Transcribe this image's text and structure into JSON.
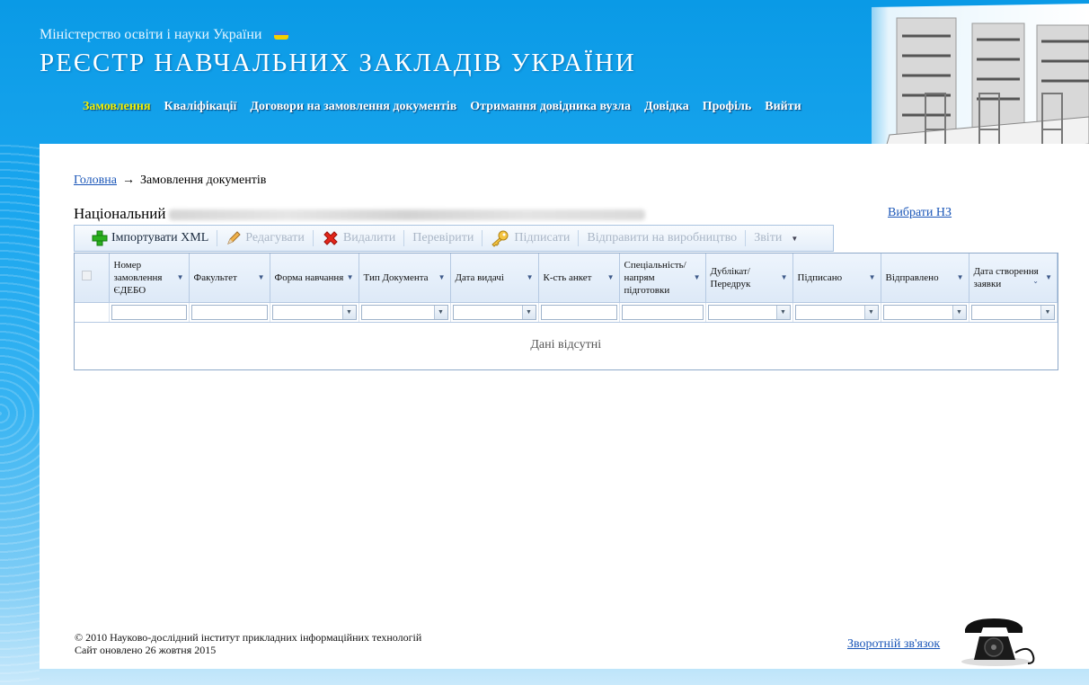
{
  "header": {
    "ministry": "Міністерство освіти і науки України",
    "title": "РЕЄСТР НАВЧАЛЬНИХ ЗАКЛАДІВ УКРАЇНИ",
    "nav": [
      {
        "label": "Замовлення",
        "active": true
      },
      {
        "label": "Кваліфікації"
      },
      {
        "label": "Договори на замовлення документів"
      },
      {
        "label": "Отримання довідника вузла"
      },
      {
        "label": "Довідка"
      },
      {
        "label": "Профіль"
      },
      {
        "label": "Вийти"
      }
    ]
  },
  "breadcrumb": {
    "home": "Головна",
    "arrow": "→",
    "current": "Замовлення документів"
  },
  "institution": {
    "prefix": "Національний",
    "choose_link": "Вибрати НЗ"
  },
  "toolbar": {
    "import": "Імпортувати XML",
    "edit": "Редагувати",
    "delete": "Видалити",
    "check": "Перевірити",
    "sign": "Підписати",
    "send": "Відправити на виробництво",
    "reports": "Звіти"
  },
  "grid": {
    "columns": [
      "Номер замовлення ЄДЕБО",
      "Факультет",
      "Форма навчання",
      "Тип Документа",
      "Дата видачі",
      "К-сть анкет",
      "Спеціальність/ напрям підготовки",
      "Дублікат/ Передрук",
      "Підписано",
      "Відправлено",
      "Дата створення заявки"
    ],
    "empty_text": "Дані відсутні"
  },
  "footer": {
    "copyright": "© 2010 Науково-дослідний інститут прикладних інформаційних технологій",
    "updated": "Сайт оновлено 26 жовтня 2015",
    "feedback": "Зворотній зв'язок"
  }
}
